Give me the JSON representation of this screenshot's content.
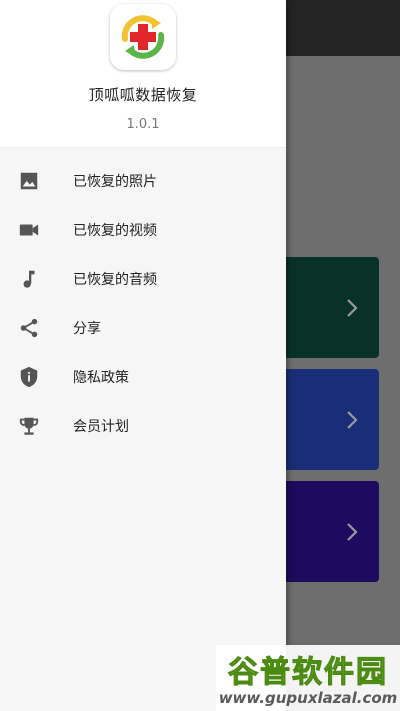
{
  "app": {
    "name": "顶呱呱数据恢复",
    "version": "1.0.1",
    "logo_icon": "recovery-cross-arrows-logo"
  },
  "menu": [
    {
      "label": "已恢复的照片",
      "icon": "image-icon"
    },
    {
      "label": "已恢复的视频",
      "icon": "video-camera-icon"
    },
    {
      "label": "已恢复的音频",
      "icon": "music-note-icon"
    },
    {
      "label": "分享",
      "icon": "share-icon"
    },
    {
      "label": "隐私政策",
      "icon": "shield-info-icon"
    },
    {
      "label": "会员计划",
      "icon": "trophy-icon"
    }
  ],
  "background_cards": [
    {
      "color": "#083127",
      "icon": "chevron-right-icon"
    },
    {
      "color": "#1a2d78",
      "icon": "chevron-right-icon"
    },
    {
      "color": "#1e0a5e",
      "icon": "chevron-right-icon"
    }
  ],
  "watermark": {
    "title": "谷普软件园",
    "url": "www.gupuxlazal.com"
  },
  "colors": {
    "drawer_bg": "#f6f6f6",
    "scrim": "#6e6e6e",
    "icon_gray": "#555555",
    "logo_red": "#e3262b",
    "logo_green": "#5ab64a",
    "logo_yellow": "#f2c233"
  }
}
